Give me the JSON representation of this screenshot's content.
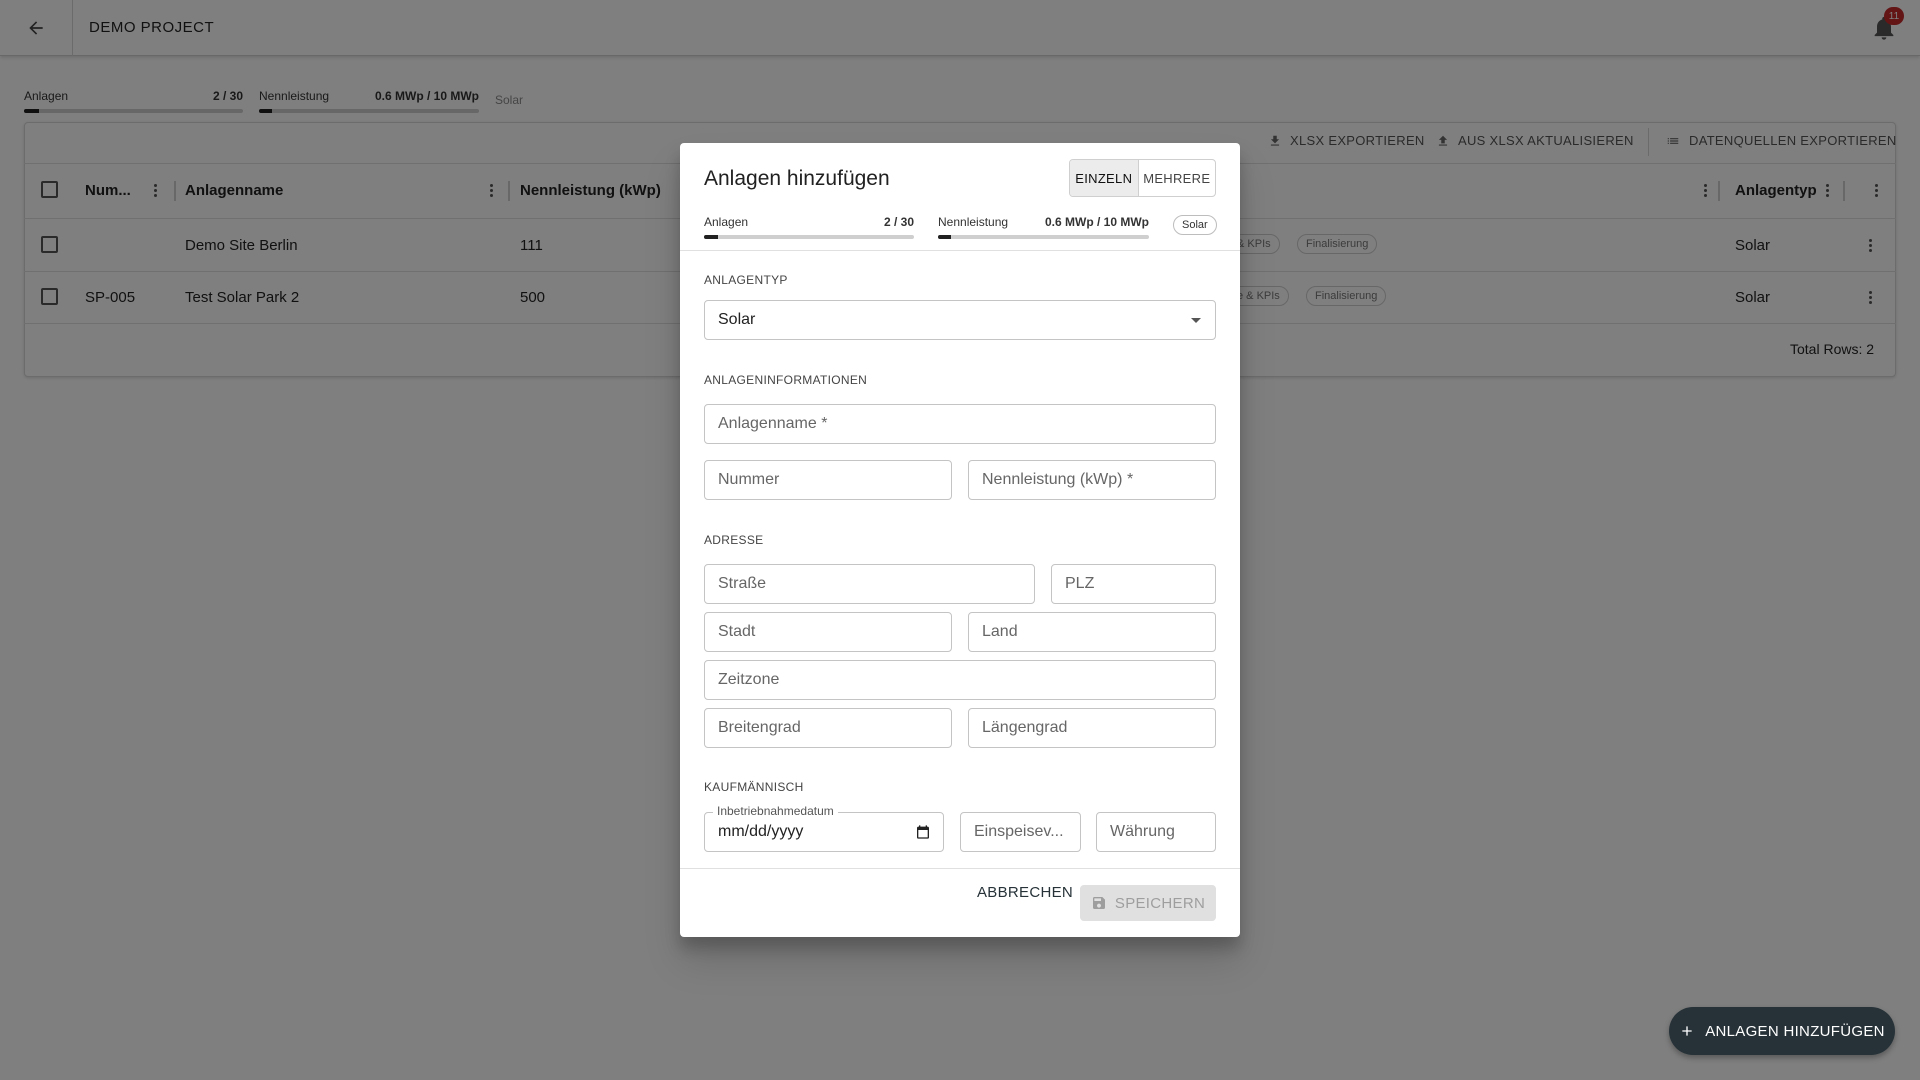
{
  "header": {
    "project_title": "DEMO PROJECT",
    "notification_count": "11"
  },
  "stats": {
    "plants_label": "Anlagen",
    "plants_value": "2 / 30",
    "plants_progress": 0.067,
    "capacity_label": "Nennleistung",
    "capacity_value": "0.6 MWp / 10 MWp",
    "capacity_progress": 0.06,
    "type_tag": "Solar"
  },
  "toolbar": {
    "export_xlsx": "XLSX EXPORTIEREN",
    "update_xlsx": "AUS XLSX AKTUALISIEREN",
    "export_sources": "DATENQUELLEN EXPORTIEREN"
  },
  "table": {
    "columns": [
      "Num...",
      "Anlagenname",
      "Nennleistung (kWp)",
      "Anlagentyp"
    ],
    "rows": [
      {
        "number": "",
        "name": "Demo Site Berlin",
        "capacity": "111",
        "stage_a": "& KPIs",
        "stage_b": "Finalisierung",
        "type": "Solar"
      },
      {
        "number": "SP-005",
        "name": "Test Solar Park 2",
        "capacity": "500",
        "stage_a": "e & KPIs",
        "stage_b": "Finalisierung",
        "type": "Solar"
      }
    ],
    "total_rows": "Total Rows: 2"
  },
  "fab": {
    "label": "ANLAGEN HINZUFÜGEN"
  },
  "modal": {
    "title": "Anlagen hinzufügen",
    "mode_single": "EINZELN",
    "mode_multiple": "MEHRERE",
    "plants_label": "Anlagen",
    "plants_value": "2 / 30",
    "plants_progress": 0.067,
    "capacity_label": "Nennleistung",
    "capacity_value": "0.6 MWp / 10 MWp",
    "capacity_progress": 0.06,
    "type_chip": "Solar",
    "section_type": "ANLAGENTYP",
    "plant_type_value": "Solar",
    "section_info": "ANLAGENINFORMATIONEN",
    "name_placeholder": "Anlagenname *",
    "number_placeholder": "Nummer",
    "capacity_placeholder": "Nennleistung (kWp) *",
    "section_address": "ADRESSE",
    "street_placeholder": "Straße",
    "zip_placeholder": "PLZ",
    "city_placeholder": "Stadt",
    "country_placeholder": "Land",
    "timezone_placeholder": "Zeitzone",
    "lat_placeholder": "Breitengrad",
    "lng_placeholder": "Längengrad",
    "section_commercial": "KAUFMÄNNISCH",
    "commissioning_label": "Inbetriebnahmedatum",
    "commissioning_value": "mm/dd/yyyy",
    "feedin_placeholder": "Einspeisev...",
    "currency_placeholder": "Währung",
    "cancel_label": "ABBRECHEN",
    "save_label": "SPEICHERN"
  }
}
